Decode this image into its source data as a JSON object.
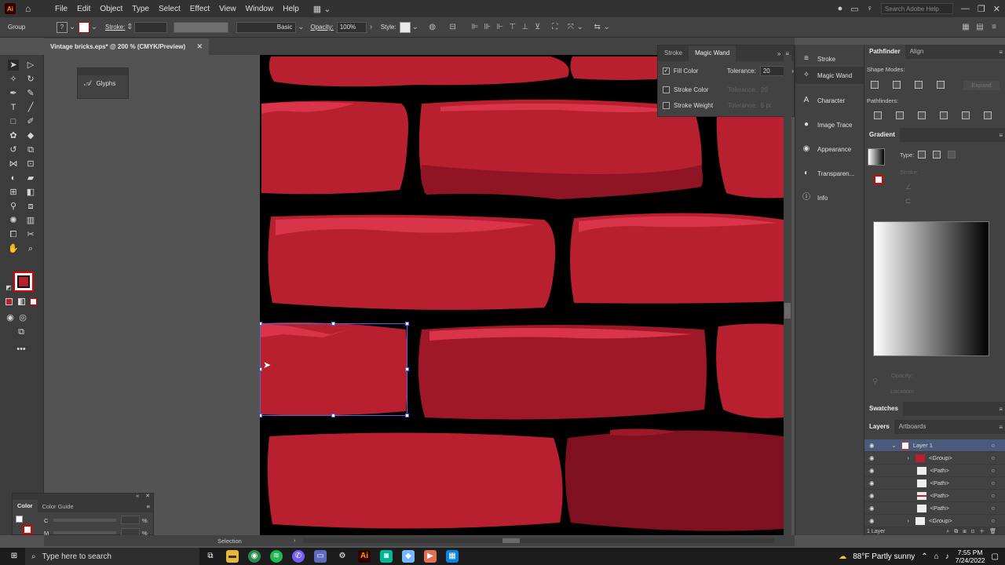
{
  "menubar": {
    "app_logo": "Ai",
    "items": [
      "File",
      "Edit",
      "Object",
      "Type",
      "Select",
      "Effect",
      "View",
      "Window",
      "Help"
    ],
    "search_placeholder": "Search Adobe Help"
  },
  "controlbar": {
    "selection_label": "Group",
    "stroke_label": "Stroke:",
    "brush_label": "Basic",
    "opacity_label": "Opacity:",
    "opacity_value": "100%",
    "style_label": "Style:"
  },
  "document": {
    "tab_title": "Vintage bricks.eps* @ 200 % (CMYK/Preview)",
    "status_tool": "Selection"
  },
  "glyphs_panel": {
    "label": "Glyphs"
  },
  "magic_wand": {
    "tabs": [
      "Stroke",
      "Magic Wand"
    ],
    "fill_color_label": "Fill Color",
    "tolerance_label": "Tolerance:",
    "tolerance_value": "20",
    "stroke_color_label": "Stroke Color",
    "stroke_weight_label": "Stroke Weight",
    "dim_tolerance_label": "Tolerance:",
    "dim_tol_value_1": "20",
    "dim_tol_value_2": "5 pt"
  },
  "panel_icons": [
    "Stroke",
    "Magic Wand",
    "Character",
    "Image Trace",
    "Appearance",
    "Transparen...",
    "Info"
  ],
  "pathfinder": {
    "tabs": [
      "Pathfinder",
      "Align"
    ],
    "shape_modes_label": "Shape Modes:",
    "pathfinders_label": "Pathfinders:",
    "expand_label": "Expand"
  },
  "gradient": {
    "title": "Gradient",
    "type_label": "Type:",
    "stroke_label": "Stroke:",
    "opacity_label": "Opacity:",
    "location_label": "Location:"
  },
  "swatches": {
    "title": "Swatches"
  },
  "layers": {
    "tabs": [
      "Layers",
      "Artboards"
    ],
    "rows": [
      "Layer 1",
      "<Group>",
      "<Path>",
      "<Path>",
      "<Path>",
      "<Path>",
      "<Group>"
    ],
    "footer": "1 Layer"
  },
  "color_panel": {
    "tabs": [
      "Color",
      "Color Guide"
    ],
    "channels": [
      "C",
      "M"
    ],
    "unit": "%"
  },
  "taskbar": {
    "search_placeholder": "Type here to search",
    "weather": "88°F  Partly sunny",
    "time": "7:55 PM",
    "date": "7/24/2022"
  },
  "colors": {
    "brick_light": "#b81f2f",
    "brick_dark": "#7e1020",
    "brick_highlight": "#d9344a",
    "mortar": "#000000",
    "selection": "#5566dd"
  }
}
